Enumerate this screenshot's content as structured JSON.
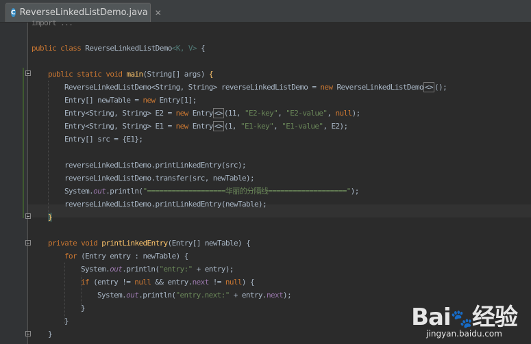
{
  "tab": {
    "title": "ReverseLinkedListDemo.java",
    "close": "✕",
    "icon": "C"
  },
  "code": {
    "import": "import ...",
    "class_decl": {
      "kw": "public class ",
      "name": "ReverseLinkedListDemo",
      "generics": "<K, V>",
      "brace": " {"
    },
    "main_decl": {
      "kw": "public static void ",
      "name": "main",
      "params": "(String[] args) ",
      "brace": "{"
    },
    "l1": {
      "a": "ReverseLinkedListDemo<String, String> reverseLinkedListDemo = ",
      "new": "new",
      "b": " ReverseLinkedListDemo",
      "dia": "<>",
      "c": "();"
    },
    "l2": {
      "a": "Entry[] newTable = ",
      "new": "new",
      "b": " Entry[1];"
    },
    "l3": {
      "a": "Entry<String, String> E2 = ",
      "new": "new",
      "b": " Entry",
      "dia": "<>",
      "c": "(11, ",
      "s1": "\"E2-key\"",
      "d": ", ",
      "s2": "\"E2-value\"",
      "e": ", ",
      "null": "null",
      "f": ");"
    },
    "l4": {
      "a": "Entry<String, String> E1 = ",
      "new": "new",
      "b": " Entry",
      "dia": "<>",
      "c": "(1, ",
      "s1": "\"E1-key\"",
      "d": ", ",
      "s2": "\"E1-value\"",
      "e": ", E2);"
    },
    "l5": "Entry[] src = {E1};",
    "l6": "reverseLinkedListDemo.printLinkedEntry(src);",
    "l7": "reverseLinkedListDemo.transfer(src, newTable);",
    "l8": {
      "a": "System.",
      "out": "out",
      "b": ".println(",
      "s": "\"===================华丽的分隔线===================\"",
      "c": ");"
    },
    "l9": "reverseLinkedListDemo.printLinkedEntry(newTable);",
    "close_main": "}",
    "ple_decl": {
      "kw": "private void ",
      "name": "printLinkedEntry",
      "params": "(Entry[] newTable) {"
    },
    "for_line": {
      "kw": "for",
      "a": " (Entry entry : newTable) {"
    },
    "p1": {
      "a": "System.",
      "out": "out",
      "b": ".println(",
      "s": "\"entry:\"",
      "c": " + entry);"
    },
    "if_line": {
      "kw": "if",
      "a": " (entry != ",
      "null1": "null",
      "b": " && entry.",
      "next": "next",
      "c": " != ",
      "null2": "null",
      "d": ") {"
    },
    "p2": {
      "a": "System.",
      "out": "out",
      "b": ".println(",
      "s": "\"entry.next:\"",
      "c": " + entry.",
      "next": "next",
      "d": ");"
    },
    "close_if": "}",
    "close_for": "}",
    "close_method": "}"
  },
  "watermark": {
    "logo_a": "Bai",
    "logo_paw": "🐾",
    "logo_b": "经验",
    "url": "jingyan.baidu.com"
  }
}
